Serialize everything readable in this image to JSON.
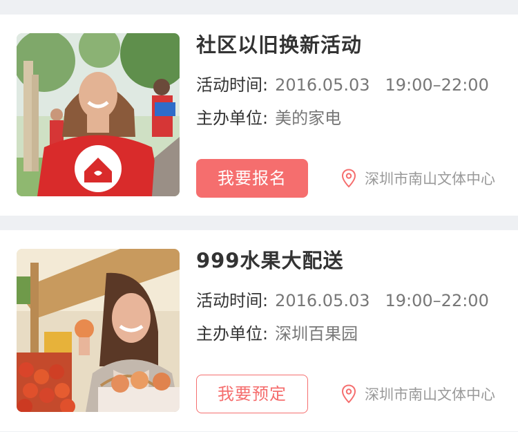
{
  "colors": {
    "accent": "#f56e6e",
    "page_bg": "#eef0f3",
    "card_bg": "#ffffff",
    "title": "#333333",
    "muted": "#777777",
    "location": "#999999"
  },
  "events": [
    {
      "title": "社区以旧换新活动",
      "time_label": "活动时间:",
      "date": "2016.05.03",
      "time": "19:00–22:00",
      "organizer_label": "主办单位:",
      "organizer": "美的家电",
      "button_label": "我要报名",
      "button_style": "filled",
      "location_icon": "map-pin-icon",
      "location": "深圳市南山文体中心"
    },
    {
      "title": "999水果大配送",
      "time_label": "活动时间:",
      "date": "2016.05.03",
      "time": "19:00–22:00",
      "organizer_label": "主办单位:",
      "organizer": "深圳百果园",
      "button_label": "我要预定",
      "button_style": "outline",
      "location_icon": "map-pin-icon",
      "location": "深圳市南山文体中心"
    }
  ]
}
